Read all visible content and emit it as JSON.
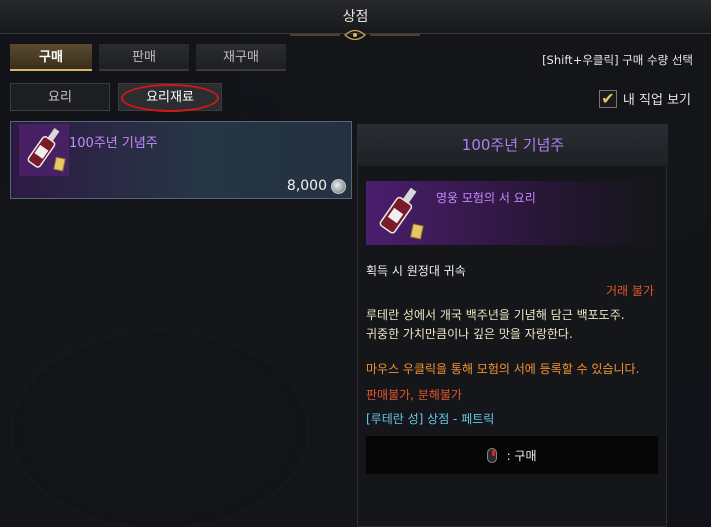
{
  "window": {
    "title": "상점"
  },
  "top_tabs": [
    {
      "label": "구매",
      "active": true
    },
    {
      "label": "판매",
      "active": false
    },
    {
      "label": "재구매",
      "active": false
    }
  ],
  "hint": "[Shift+우클릭] 구매 수량 선택",
  "sub_tabs": [
    {
      "label": "요리",
      "active": false
    },
    {
      "label": "요리재료",
      "active": true
    }
  ],
  "my_class_filter": {
    "label": "내 직업 보기",
    "checked": true
  },
  "list": [
    {
      "name": "100주년 기념주",
      "price": "8,000",
      "currency_icon": "silver-coin-icon"
    }
  ],
  "detail": {
    "title": "100주년 기념주",
    "item_type": "영웅 모험의 서 요리",
    "bind": "획득 시 원정대 귀속",
    "trade": "거래 불가",
    "description_lines": [
      "루테란 성에서 개국 백주년을 기념해 담근 백포도주.",
      "귀중한 가치만큼이나 깊은 맛을 자랑한다."
    ],
    "register": "마우스 우클릭을 통해 모험의 서에 등록할 수 있습니다.",
    "restrictions": "판매불가, 분해불가",
    "source": "[루테란 성] 상점 - 페트릭",
    "buy_hint": ": 구매"
  },
  "colors": {
    "accent_gold": "#d9b56a",
    "epic_purple": "#c48aff",
    "warning_red": "#e0562b",
    "flavor_text": "#f0e7c4",
    "info_orange": "#f39431",
    "source_cyan": "#67c7e6",
    "highlight_circle": "#d01818"
  }
}
